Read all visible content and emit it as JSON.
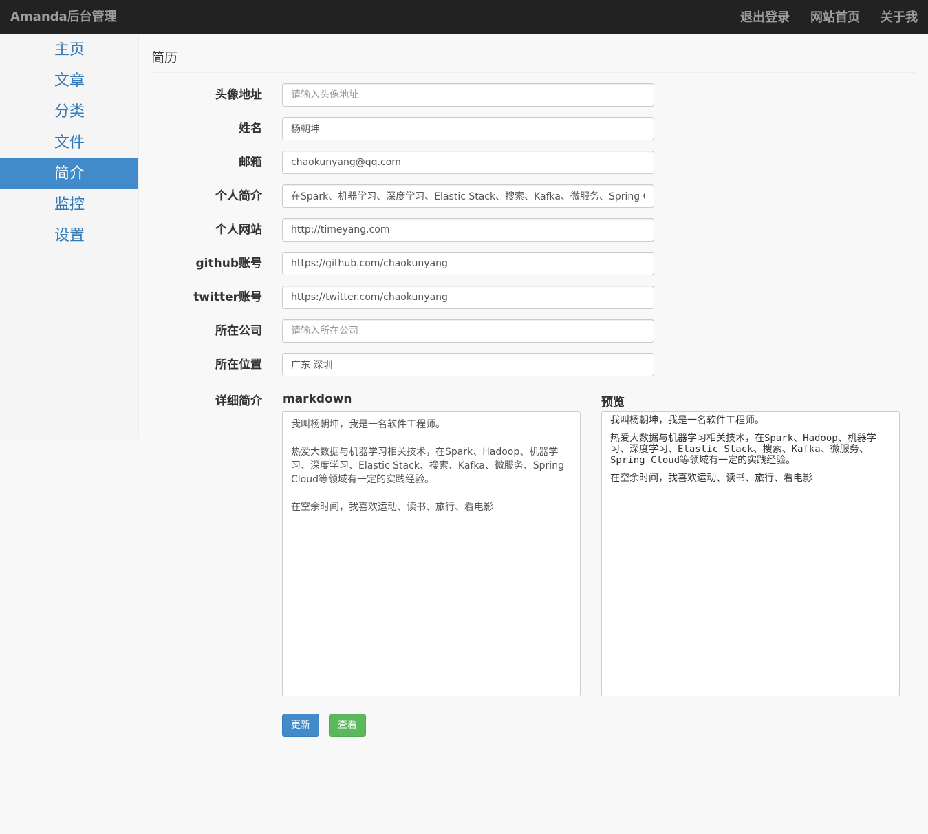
{
  "navbar": {
    "brand": "Amanda后台管理",
    "links": [
      "退出登录",
      "网站首页",
      "关于我"
    ]
  },
  "sidebar": {
    "items": [
      "主页",
      "文章",
      "分类",
      "文件",
      "简介",
      "监控",
      "设置"
    ],
    "active": "简介"
  },
  "page": {
    "title": "简历"
  },
  "form": {
    "avatar": {
      "label": "头像地址",
      "value": "",
      "placeholder": "请输入头像地址"
    },
    "name": {
      "label": "姓名",
      "value": "杨朝坤",
      "placeholder": ""
    },
    "email": {
      "label": "邮箱",
      "value": "chaokunyang@qq.com",
      "placeholder": ""
    },
    "intro": {
      "label": "个人简介",
      "value": "在Spark、机器学习、深度学习、Elastic Stack、搜索、Kafka、微服务、Spring Cloud等领域有一定的实践经验",
      "placeholder": ""
    },
    "website": {
      "label": "个人网站",
      "value": "http://timeyang.com",
      "placeholder": ""
    },
    "github": {
      "label": "github账号",
      "value": "https://github.com/chaokunyang",
      "placeholder": ""
    },
    "twitter": {
      "label": "twitter账号",
      "value": "https://twitter.com/chaokunyang",
      "placeholder": ""
    },
    "company": {
      "label": "所在公司",
      "value": "",
      "placeholder": "请输入所在公司"
    },
    "location": {
      "label": "所在位置",
      "value": "广东 深圳",
      "placeholder": ""
    },
    "detail": {
      "label": "详细简介",
      "markdown_title": "markdown",
      "preview_title": "预览",
      "markdown": "我叫杨朝坤，我是一名软件工程师。\n\n热爱大数据与机器学习相关技术，在Spark、Hadoop、机器学习、深度学习、Elastic Stack、搜索、Kafka、微服务、Spring Cloud等领域有一定的实践经验。\n\n在空余时间，我喜欢运动、读书、旅行、看电影",
      "preview": [
        "我叫杨朝坤，我是一名软件工程师。",
        "热爱大数据与机器学习相关技术，在Spark、Hadoop、机器学习、深度学习、Elastic Stack、搜索、Kafka、微服务、Spring Cloud等领域有一定的实践经验。",
        "在空余时间，我喜欢运动、读书、旅行、看电影"
      ]
    }
  },
  "buttons": {
    "update": "更新",
    "view": "查看"
  },
  "colors": {
    "navbar": "#222222",
    "accent": "#428bca",
    "success": "#5cb85c",
    "link": "#337ab7"
  }
}
